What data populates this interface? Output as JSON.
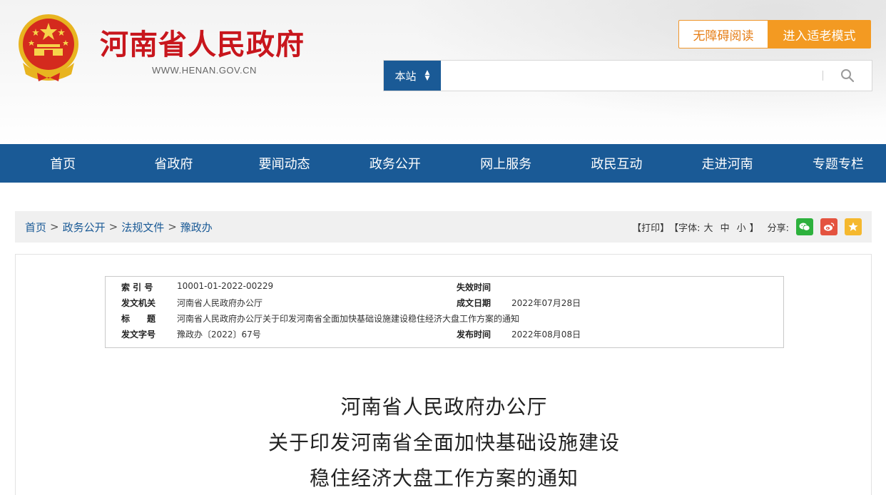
{
  "header": {
    "site_name": "河南省人民政府",
    "site_url": "WWW.HENAN.GOV.CN",
    "accessibility_label": "无障碍阅读",
    "elder_mode_label": "进入适老模式"
  },
  "search": {
    "scope": "本站",
    "placeholder": ""
  },
  "nav": {
    "items": [
      "首页",
      "省政府",
      "要闻动态",
      "政务公开",
      "网上服务",
      "政民互动",
      "走进河南",
      "专题专栏"
    ]
  },
  "breadcrumb": {
    "items": [
      "首页",
      "政务公开",
      "法规文件",
      "豫政办"
    ],
    "separator": ">"
  },
  "tools": {
    "print": "【打印】",
    "font_prefix": "【字体:",
    "font_large": "大",
    "font_medium": "中",
    "font_small": "小",
    "font_suffix": "】",
    "share_label": "分享:"
  },
  "meta": {
    "index_label": "索 引 号",
    "index_value": "10001-01-2022-00229",
    "expire_label": "失效时间",
    "expire_value": "",
    "issuer_label": "发文机关",
    "issuer_value": "河南省人民政府办公厅",
    "written_label": "成文日期",
    "written_value": "2022年07月28日",
    "title_label": "标　　题",
    "title_value": "河南省人民政府办公厅关于印发河南省全面加快基础设施建设稳住经济大盘工作方案的通知",
    "doc_no_label": "发文字号",
    "doc_no_value": "豫政办〔2022〕67号",
    "publish_label": "发布时间",
    "publish_value": "2022年08月08日"
  },
  "document": {
    "title_line1": "河南省人民政府办公厅",
    "title_line2": "关于印发河南省全面加快基础设施建设",
    "title_line3": "稳住经济大盘工作方案的通知"
  },
  "colors": {
    "brand_red": "#c8161d",
    "nav_blue": "#1a5a96",
    "accent_orange": "#f39a22"
  }
}
